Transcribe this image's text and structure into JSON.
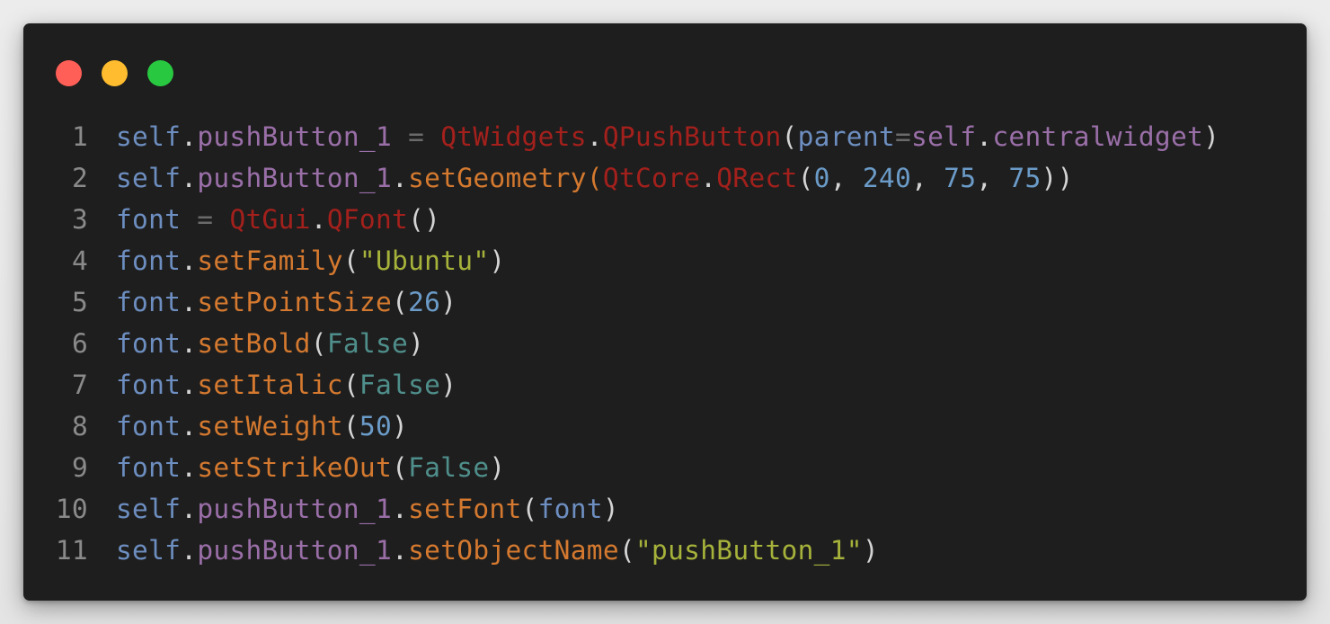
{
  "window": {
    "traffic_lights": [
      {
        "name": "close",
        "color": "#ff5f57"
      },
      {
        "name": "minimize",
        "color": "#febc2e"
      },
      {
        "name": "maximize",
        "color": "#28c840"
      }
    ]
  },
  "colors": {
    "self": "#6d8ec0",
    "attr": "#9a6fa8",
    "method": "#d4792f",
    "module": "#a3201c",
    "punct": "#d4d4d4",
    "op": "#6a6a6a",
    "number": "#6b9bc8",
    "string": "#a6b23a",
    "bool": "#4f8f8b",
    "param": "#9a6fa8"
  },
  "code_lines": [
    {
      "num": "1",
      "tokens": [
        {
          "t": "self",
          "c": "self"
        },
        {
          "t": ".",
          "c": "punct"
        },
        {
          "t": "pushButton_1",
          "c": "attr"
        },
        {
          "t": " = ",
          "c": "op"
        },
        {
          "t": "QtWidgets",
          "c": "module"
        },
        {
          "t": ".",
          "c": "punct"
        },
        {
          "t": "QPushButton",
          "c": "module"
        },
        {
          "t": "(",
          "c": "punct"
        },
        {
          "t": "parent",
          "c": "self"
        },
        {
          "t": "=",
          "c": "op"
        },
        {
          "t": "self",
          "c": "attr"
        },
        {
          "t": ".",
          "c": "punct"
        },
        {
          "t": "centralwidget",
          "c": "attr"
        },
        {
          "t": ")",
          "c": "punct"
        }
      ]
    },
    {
      "num": "2",
      "tokens": [
        {
          "t": "self",
          "c": "self"
        },
        {
          "t": ".",
          "c": "punct"
        },
        {
          "t": "pushButton_1",
          "c": "attr"
        },
        {
          "t": ".",
          "c": "punct"
        },
        {
          "t": "setGeometry",
          "c": "method"
        },
        {
          "t": "(",
          "c": "method"
        },
        {
          "t": "QtCore",
          "c": "module"
        },
        {
          "t": ".",
          "c": "punct"
        },
        {
          "t": "QRect",
          "c": "module"
        },
        {
          "t": "(",
          "c": "punct"
        },
        {
          "t": "0",
          "c": "number"
        },
        {
          "t": ", ",
          "c": "punct"
        },
        {
          "t": "240",
          "c": "number"
        },
        {
          "t": ", ",
          "c": "punct"
        },
        {
          "t": "75",
          "c": "number"
        },
        {
          "t": ", ",
          "c": "punct"
        },
        {
          "t": "75",
          "c": "number"
        },
        {
          "t": "))",
          "c": "punct"
        }
      ]
    },
    {
      "num": "3",
      "tokens": [
        {
          "t": "font",
          "c": "self"
        },
        {
          "t": " = ",
          "c": "op"
        },
        {
          "t": "QtGui",
          "c": "module"
        },
        {
          "t": ".",
          "c": "punct"
        },
        {
          "t": "QFont",
          "c": "module"
        },
        {
          "t": "()",
          "c": "punct"
        }
      ]
    },
    {
      "num": "4",
      "tokens": [
        {
          "t": "font",
          "c": "self"
        },
        {
          "t": ".",
          "c": "punct"
        },
        {
          "t": "setFamily",
          "c": "method"
        },
        {
          "t": "(",
          "c": "punct"
        },
        {
          "t": "\"Ubuntu\"",
          "c": "string"
        },
        {
          "t": ")",
          "c": "punct"
        }
      ]
    },
    {
      "num": "5",
      "tokens": [
        {
          "t": "font",
          "c": "self"
        },
        {
          "t": ".",
          "c": "punct"
        },
        {
          "t": "setPointSize",
          "c": "method"
        },
        {
          "t": "(",
          "c": "punct"
        },
        {
          "t": "26",
          "c": "number"
        },
        {
          "t": ")",
          "c": "punct"
        }
      ]
    },
    {
      "num": "6",
      "tokens": [
        {
          "t": "font",
          "c": "self"
        },
        {
          "t": ".",
          "c": "punct"
        },
        {
          "t": "setBold",
          "c": "method"
        },
        {
          "t": "(",
          "c": "punct"
        },
        {
          "t": "False",
          "c": "bool"
        },
        {
          "t": ")",
          "c": "punct"
        }
      ]
    },
    {
      "num": "7",
      "tokens": [
        {
          "t": "font",
          "c": "self"
        },
        {
          "t": ".",
          "c": "punct"
        },
        {
          "t": "setItalic",
          "c": "method"
        },
        {
          "t": "(",
          "c": "punct"
        },
        {
          "t": "False",
          "c": "bool"
        },
        {
          "t": ")",
          "c": "punct"
        }
      ]
    },
    {
      "num": "8",
      "tokens": [
        {
          "t": "font",
          "c": "self"
        },
        {
          "t": ".",
          "c": "punct"
        },
        {
          "t": "setWeight",
          "c": "method"
        },
        {
          "t": "(",
          "c": "punct"
        },
        {
          "t": "50",
          "c": "number"
        },
        {
          "t": ")",
          "c": "punct"
        }
      ]
    },
    {
      "num": "9",
      "tokens": [
        {
          "t": "font",
          "c": "self"
        },
        {
          "t": ".",
          "c": "punct"
        },
        {
          "t": "setStrikeOut",
          "c": "method"
        },
        {
          "t": "(",
          "c": "punct"
        },
        {
          "t": "False",
          "c": "bool"
        },
        {
          "t": ")",
          "c": "punct"
        }
      ]
    },
    {
      "num": "10",
      "tokens": [
        {
          "t": "self",
          "c": "self"
        },
        {
          "t": ".",
          "c": "punct"
        },
        {
          "t": "pushButton_1",
          "c": "attr"
        },
        {
          "t": ".",
          "c": "punct"
        },
        {
          "t": "setFont",
          "c": "method"
        },
        {
          "t": "(",
          "c": "punct"
        },
        {
          "t": "font",
          "c": "self"
        },
        {
          "t": ")",
          "c": "punct"
        }
      ]
    },
    {
      "num": "11",
      "tokens": [
        {
          "t": "self",
          "c": "self"
        },
        {
          "t": ".",
          "c": "punct"
        },
        {
          "t": "pushButton_1",
          "c": "attr"
        },
        {
          "t": ".",
          "c": "punct"
        },
        {
          "t": "setObjectName",
          "c": "method"
        },
        {
          "t": "(",
          "c": "punct"
        },
        {
          "t": "\"pushButton_1\"",
          "c": "string"
        },
        {
          "t": ")",
          "c": "punct"
        }
      ]
    }
  ]
}
